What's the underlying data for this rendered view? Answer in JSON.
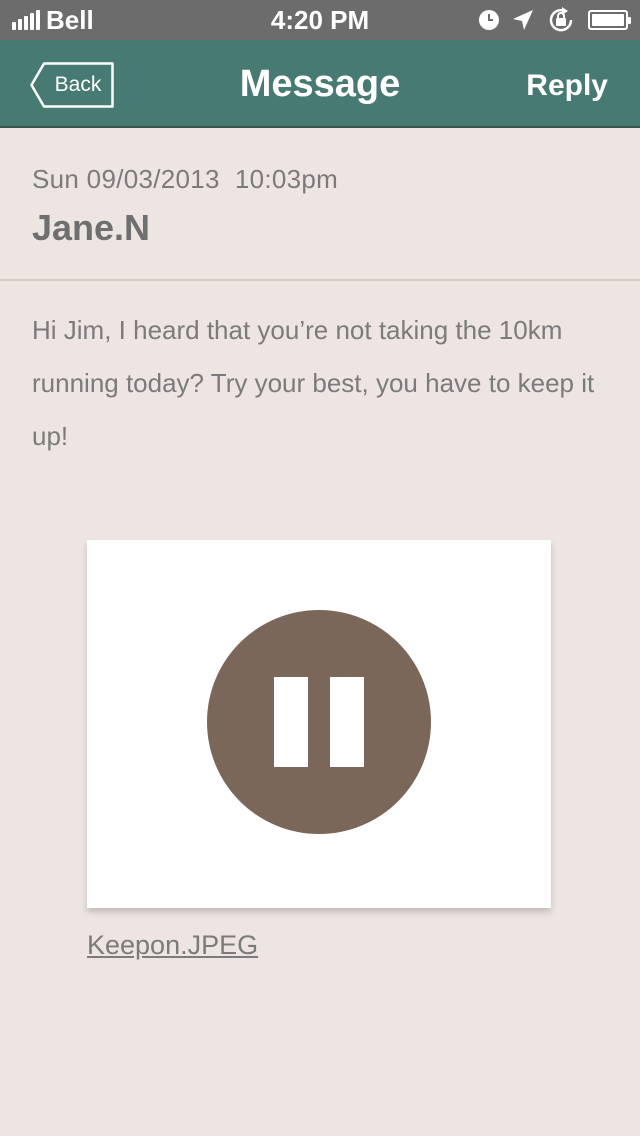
{
  "status_bar": {
    "carrier": "Bell",
    "time": "4:20 PM",
    "icons": [
      "signal-icon",
      "alarm-icon",
      "location-icon",
      "rotation-lock-icon",
      "battery-icon"
    ],
    "battery_level": 1.0
  },
  "nav": {
    "back_label": "Back",
    "title": "Message",
    "reply_label": "Reply"
  },
  "message": {
    "date": "Sun 09/03/2013  10:03pm",
    "sender": "Jane.N",
    "body": "Hi Jim, I heard that you’re not taking the 10km running today? Try your best, you have to keep it up!"
  },
  "attachment": {
    "filename": "Keepon.JPEG",
    "icon": "pause-icon"
  },
  "colors": {
    "nav_background": "#477a72",
    "page_background": "#ede5e1",
    "pause_circle": "#7a6759",
    "text_gray": "#7b7b7b"
  }
}
